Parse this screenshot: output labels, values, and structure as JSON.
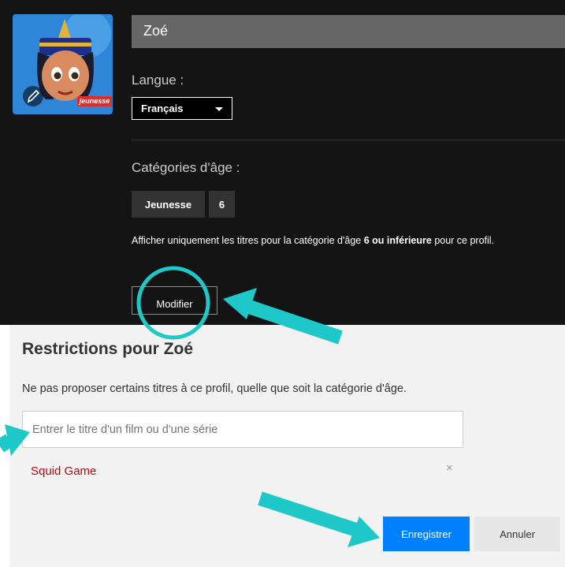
{
  "profile": {
    "name": "Zoé",
    "avatar_badge": "jeunesse"
  },
  "language": {
    "label": "Langue :",
    "selected": "Français"
  },
  "age": {
    "label": "Catégories d'âge :",
    "category": "Jeunesse",
    "rating": "6",
    "desc_before": "Afficher uniquement les titres pour la catégorie d'âge ",
    "desc_bold": "6 ou inférieure",
    "desc_after": " pour ce profil."
  },
  "buttons": {
    "modify": "Modifier",
    "save": "Enregistrer",
    "cancel": "Annuler"
  },
  "restrictions": {
    "title": "Restrictions pour Zoé",
    "description": "Ne pas proposer certains titres à ce profil, quelle que soit la catégorie d'âge.",
    "input_placeholder": "Entrer le titre d'un film ou d'une série",
    "input_value": "",
    "blocked_titles": [
      "Squid Game"
    ],
    "remove_glyph": "×"
  },
  "colors": {
    "dark_bg": "#141414",
    "light_bg": "#f2f2f2",
    "primary_button": "#0080ff",
    "blocked_title": "#b20710",
    "annotation": "#1fc8c8"
  },
  "icons": [
    "pencil-icon",
    "caret-down-icon",
    "close-icon",
    "arrow-annotation",
    "circle-annotation"
  ]
}
